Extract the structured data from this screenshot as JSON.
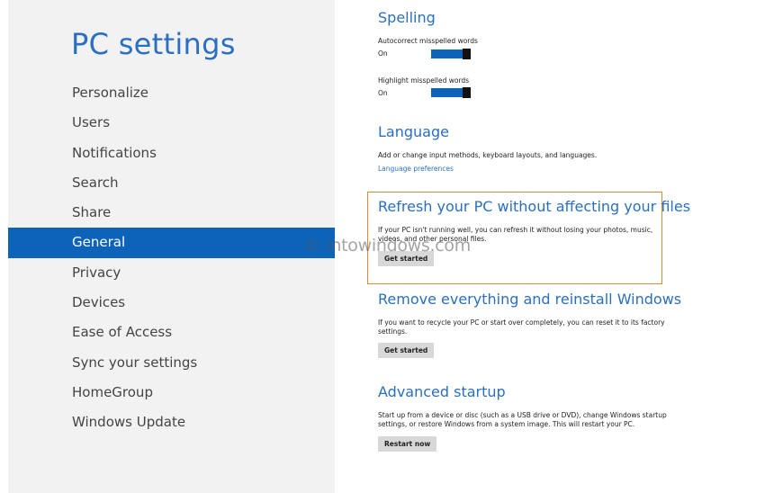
{
  "sidebar": {
    "title": "PC settings",
    "items": [
      {
        "label": "Personalize"
      },
      {
        "label": "Users"
      },
      {
        "label": "Notifications"
      },
      {
        "label": "Search"
      },
      {
        "label": "Share"
      },
      {
        "label": "General",
        "selected": true
      },
      {
        "label": "Privacy"
      },
      {
        "label": "Devices"
      },
      {
        "label": "Ease of Access"
      },
      {
        "label": "Sync your settings"
      },
      {
        "label": "HomeGroup"
      },
      {
        "label": "Windows Update"
      }
    ]
  },
  "spelling": {
    "heading": "Spelling",
    "autocorrect_label": "Autocorrect misspelled words",
    "autocorrect_state": "On",
    "highlight_label": "Highlight misspelled words",
    "highlight_state": "On"
  },
  "language": {
    "heading": "Language",
    "description": "Add or change input methods, keyboard layouts, and languages.",
    "link": "Language preferences"
  },
  "refresh": {
    "heading": "Refresh your PC without affecting your files",
    "description": "If your PC isn't running well, you can refresh it without losing your photos, music, videos, and other personal files.",
    "button": "Get started"
  },
  "reset": {
    "heading": "Remove everything and reinstall Windows",
    "description": "If you want to recycle your PC or start over completely, you can reset it to its factory settings.",
    "button": "Get started"
  },
  "advanced": {
    "heading": "Advanced startup",
    "description": "Start up from a device or disc (such as a USB drive or DVD), change Windows startup settings, or restore Windows from a system image. This will restart your PC.",
    "button": "Restart now"
  },
  "watermark": "© intowindows.com",
  "colors": {
    "accent": "#0c63b8",
    "heading_blue": "#2a6fc0",
    "highlight_border": "#e48a2a"
  }
}
